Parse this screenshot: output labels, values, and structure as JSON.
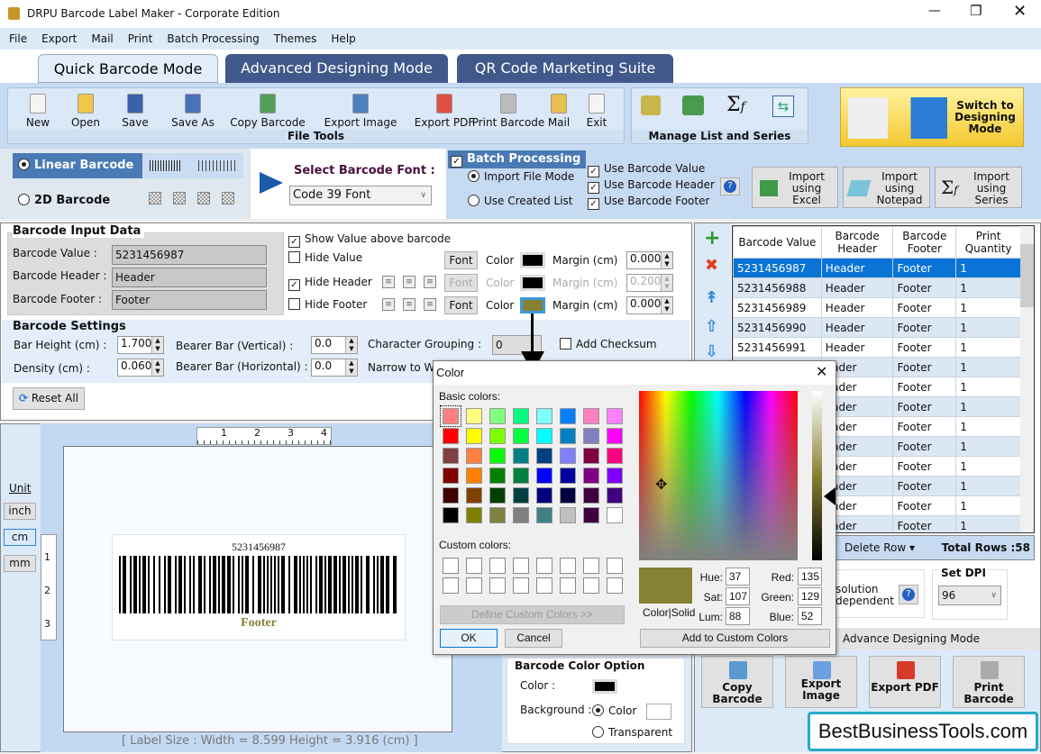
{
  "window": {
    "title": "DRPU Barcode Label Maker - Corporate Edition"
  },
  "menu": [
    "File",
    "Export",
    "Mail",
    "Print",
    "Batch Processing",
    "Themes",
    "Help"
  ],
  "tabs": [
    {
      "label": "Quick Barcode Mode",
      "active": true
    },
    {
      "label": "Advanced Designing Mode"
    },
    {
      "label": "QR Code Marketing Suite"
    }
  ],
  "file_tools": {
    "title": "File Tools",
    "items": [
      {
        "label": "New",
        "icon": "new-file-icon"
      },
      {
        "label": "Open",
        "icon": "open-folder-icon"
      },
      {
        "label": "Save",
        "icon": "save-icon"
      },
      {
        "label": "Save As",
        "icon": "save-as-icon"
      },
      {
        "label": "Copy Barcode",
        "icon": "copy-barcode-icon"
      },
      {
        "label": "Export Image",
        "icon": "export-image-icon"
      },
      {
        "label": "Export PDF",
        "icon": "export-pdf-icon"
      },
      {
        "label": "Print Barcode",
        "icon": "printer-icon"
      },
      {
        "label": "Mail",
        "icon": "mail-icon"
      },
      {
        "label": "Exit",
        "icon": "exit-icon"
      }
    ]
  },
  "manage": {
    "title": "Manage List and Series"
  },
  "switch_button": "Switch to Designing Mode",
  "barcode_type": {
    "linear": "Linear Barcode",
    "twod": "2D Barcode",
    "selected": "linear"
  },
  "font_select": {
    "label": "Select Barcode Font :",
    "value": "Code 39 Font"
  },
  "batch": {
    "title": "Batch Processing",
    "checked": true,
    "import_file": "Import File Mode",
    "use_created": "Use Created List",
    "use_value": "Use Barcode Value",
    "use_header": "Use Barcode Header",
    "use_footer": "Use Barcode Footer",
    "import_excel": "Import using Excel",
    "import_notepad": "Import using Notepad",
    "import_series": "Import using Series"
  },
  "input": {
    "title": "Barcode Input Data",
    "value_label": "Barcode Value :",
    "value": "5231456987",
    "header_label": "Barcode Header :",
    "header": "Header",
    "footer_label": "Barcode Footer :",
    "footer": "Footer"
  },
  "options": {
    "show_value": "Show Value above barcode",
    "hide_value": "Hide Value",
    "hide_header": "Hide Header",
    "hide_footer": "Hide Footer",
    "font": "Font",
    "color": "Color",
    "margin": "Margin (cm)",
    "value_margin": "0.000",
    "header_margin": "0.200",
    "footer_margin": "0.000",
    "footer_color": "#878134"
  },
  "settings": {
    "title": "Barcode Settings",
    "bar_height_label": "Bar Height (cm) :",
    "bar_height": "1.700",
    "density_label": "Density (cm) :",
    "density": "0.060",
    "bearer_v_label": "Bearer Bar (Vertical) :",
    "bearer_v": "0.0",
    "bearer_h_label": "Bearer Bar (Horizontal) :",
    "bearer_h": "0.0",
    "grouping_label": "Character Grouping  :",
    "grouping": "0",
    "narrow_label": "Narrow to W",
    "checksum": "Add Checksum",
    "reset": "Reset All"
  },
  "canvas": {
    "unit_label": "Unit",
    "units": [
      "inch",
      "cm",
      "mm"
    ],
    "selected_unit": "cm",
    "ruler_h": [
      "1",
      "2",
      "3",
      "4"
    ],
    "ruler_v": [
      "1",
      "2",
      "3"
    ],
    "barcode_text": "5231456987",
    "footer_text": "Footer",
    "label_size": "[ Label Size : Width = 8.599  Height = 3.916 (cm) ]"
  },
  "table": {
    "columns": [
      "Barcode Value",
      "Barcode Header",
      "Barcode Footer",
      "Print Quantity"
    ],
    "rows": [
      [
        "5231456987",
        "Header",
        "Footer",
        "1"
      ],
      [
        "5231456988",
        "Header",
        "Footer",
        "1"
      ],
      [
        "5231456989",
        "Header",
        "Footer",
        "1"
      ],
      [
        "5231456990",
        "Header",
        "Footer",
        "1"
      ],
      [
        "5231456991",
        "Header",
        "Footer",
        "1"
      ],
      [
        "",
        "eader",
        "Footer",
        "1"
      ],
      [
        "",
        "eader",
        "Footer",
        "1"
      ],
      [
        "",
        "eader",
        "Footer",
        "1"
      ],
      [
        "",
        "eader",
        "Footer",
        "1"
      ],
      [
        "",
        "eader",
        "Footer",
        "1"
      ],
      [
        "",
        "eader",
        "Footer",
        "1"
      ],
      [
        "",
        "eader",
        "Footer",
        "1"
      ],
      [
        "",
        "eader",
        "Footer",
        "1"
      ],
      [
        "",
        "eader",
        "Footer",
        "1"
      ]
    ],
    "delete_row": "Delete Row",
    "total_rows": "Total Rows :58"
  },
  "dpi": {
    "res_text1": "solution",
    "res_text2": "dependent",
    "label": "Set DPI",
    "value": "96"
  },
  "advance_bar": "Advance Designing Mode",
  "bottom_buttons": [
    "Copy Barcode",
    "Export Image",
    "Export PDF",
    "Print Barcode"
  ],
  "color_option": {
    "title": "Barcode Color Option",
    "color_label": "Color :",
    "bg_label": "Background :",
    "bg_color": "Color",
    "transparent": "Transparent"
  },
  "watermark": "BestBusinessTools.com",
  "color_dialog": {
    "title": "Color",
    "basic_label": "Basic colors:",
    "custom_label": "Custom colors:",
    "define": "Define Custom Colors >>",
    "ok": "OK",
    "cancel": "Cancel",
    "color_solid": "Color|Solid",
    "hue_label": "Hue:",
    "hue": "37",
    "sat_label": "Sat:",
    "sat": "107",
    "lum_label": "Lum:",
    "lum": "88",
    "red_label": "Red:",
    "red": "135",
    "green_label": "Green:",
    "green": "129",
    "blue_label": "Blue:",
    "blue": "52",
    "add_custom": "Add to Custom Colors",
    "selected": "#878134",
    "basic_colors": [
      "#ff8080",
      "#ffff80",
      "#80ff80",
      "#00ff80",
      "#80ffff",
      "#0080ff",
      "#ff80c0",
      "#ff80ff",
      "#ff0000",
      "#ffff00",
      "#80ff00",
      "#00ff40",
      "#00ffff",
      "#0080c0",
      "#8080c0",
      "#ff00ff",
      "#804040",
      "#ff8040",
      "#00ff00",
      "#008080",
      "#004080",
      "#8080ff",
      "#800040",
      "#ff0080",
      "#800000",
      "#ff8000",
      "#008000",
      "#008040",
      "#0000ff",
      "#0000a0",
      "#800080",
      "#8000ff",
      "#400000",
      "#804000",
      "#004000",
      "#004040",
      "#000080",
      "#000040",
      "#400040",
      "#400080",
      "#000000",
      "#808000",
      "#808040",
      "#808080",
      "#408080",
      "#c0c0c0",
      "#400040",
      "#ffffff"
    ]
  }
}
